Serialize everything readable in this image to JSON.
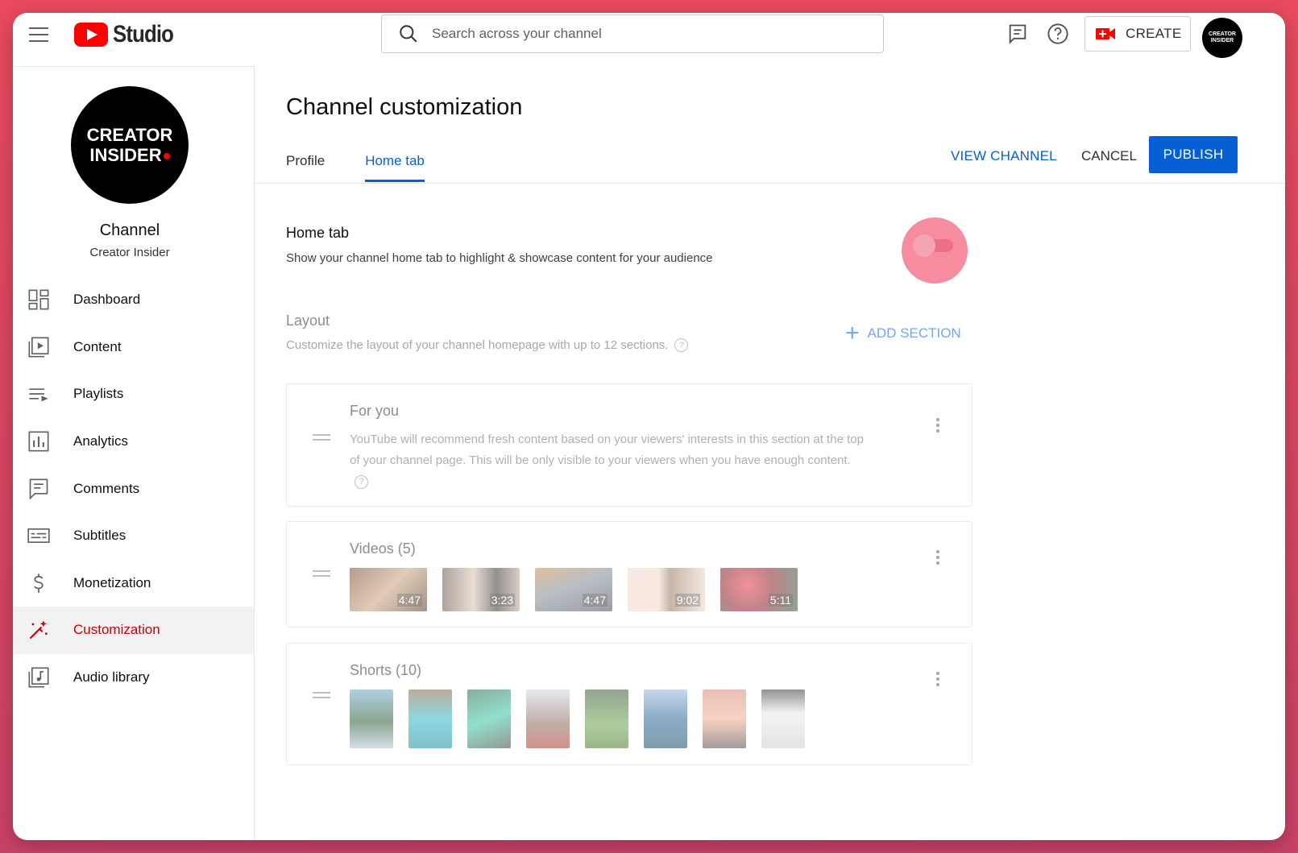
{
  "topbar": {
    "logo_text": "Studio",
    "search_placeholder": "Search across your channel",
    "create_label": "CREATE",
    "avatar_text": "CREATOR INSIDER"
  },
  "sidebar": {
    "avatar_line1": "CREATOR",
    "avatar_line2": "INSIDER",
    "channel_title": "Channel",
    "channel_name": "Creator Insider",
    "items": [
      {
        "label": "Dashboard",
        "icon": "dashboard-icon"
      },
      {
        "label": "Content",
        "icon": "content-icon"
      },
      {
        "label": "Playlists",
        "icon": "playlists-icon"
      },
      {
        "label": "Analytics",
        "icon": "analytics-icon"
      },
      {
        "label": "Comments",
        "icon": "comments-icon"
      },
      {
        "label": "Subtitles",
        "icon": "subtitles-icon"
      },
      {
        "label": "Monetization",
        "icon": "monetization-icon"
      },
      {
        "label": "Customization",
        "icon": "customization-icon",
        "active": true
      },
      {
        "label": "Audio library",
        "icon": "audio-library-icon"
      }
    ]
  },
  "main": {
    "title": "Channel customization",
    "tabs": [
      {
        "label": "Profile"
      },
      {
        "label": "Home tab",
        "active": true
      }
    ],
    "view_channel": "VIEW CHANNEL",
    "cancel": "CANCEL",
    "publish": "PUBLISH",
    "home_tab": {
      "title": "Home tab",
      "description": "Show your channel home tab to highlight & showcase content for your audience",
      "toggle_on": false
    },
    "layout": {
      "title": "Layout",
      "description": "Customize the layout of your channel homepage with up to 12 sections.",
      "add_section": "ADD SECTION"
    },
    "sections": [
      {
        "title": "For you",
        "description": "YouTube will recommend fresh content based on your viewers' interests in this section at the top of your channel page. This will be only visible to your viewers when you have enough content."
      },
      {
        "title": "Videos (5)",
        "durations": [
          "4:47",
          "3:23",
          "4:47",
          "9:02",
          "5:11"
        ]
      },
      {
        "title": "Shorts (10)",
        "count": 8
      }
    ]
  },
  "colors": {
    "accent_blue": "#065fd4",
    "brand_red": "#ff0000",
    "toggle_highlight": "#f78ca0"
  }
}
